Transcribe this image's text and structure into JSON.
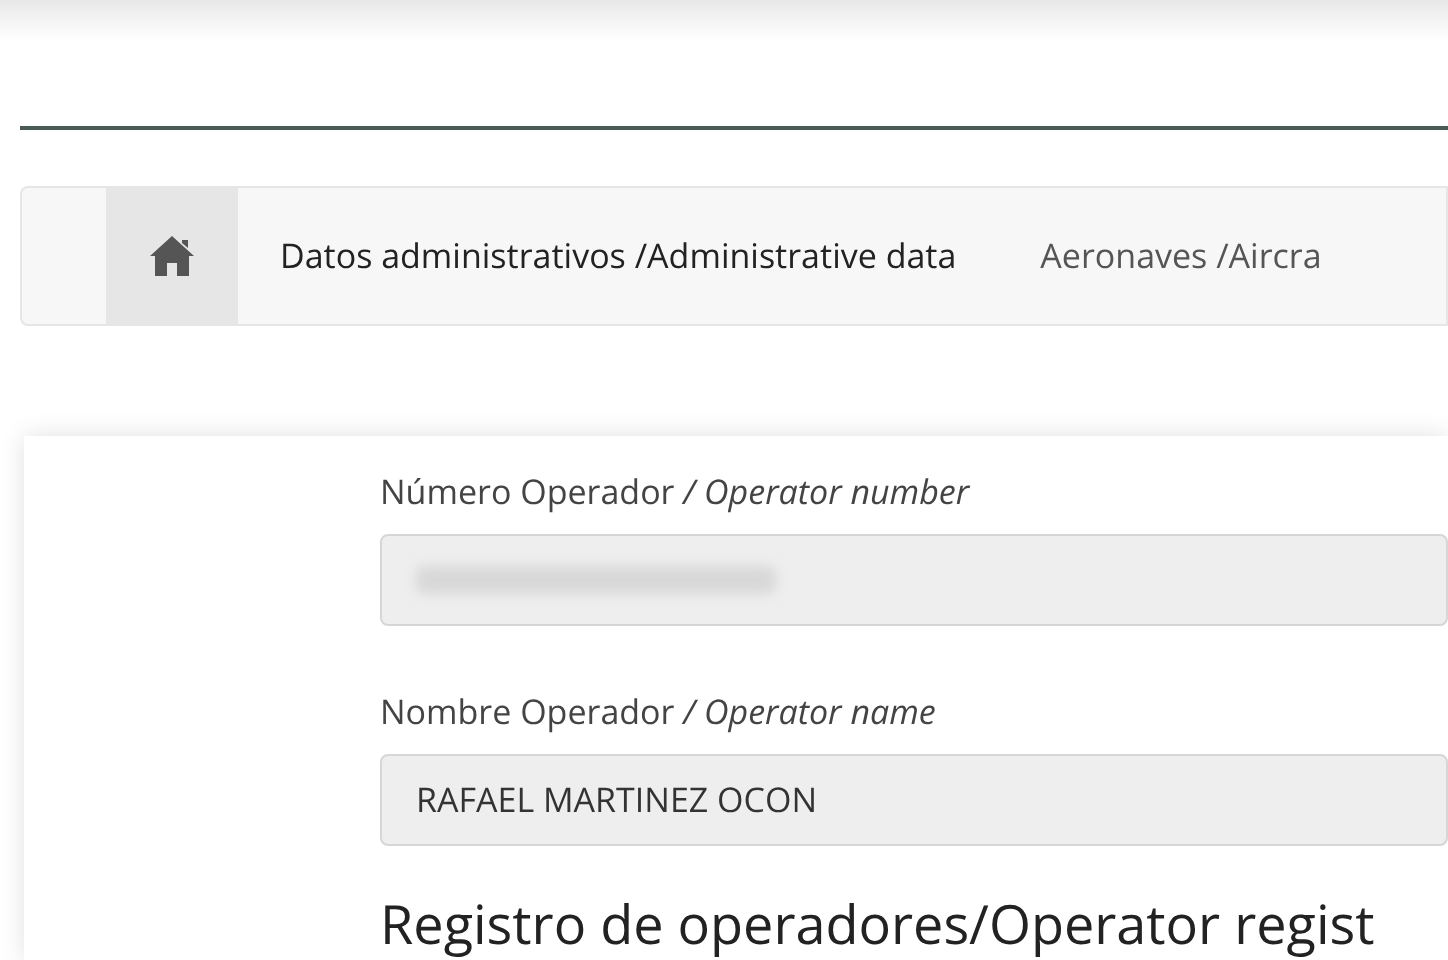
{
  "tabs": [
    {
      "kind": "home",
      "selected": true
    },
    {
      "kind": "text",
      "label": "Datos administrativos /Administrative data",
      "selected": false
    },
    {
      "kind": "text",
      "label": "Aeronaves /Aircra",
      "selected": false
    }
  ],
  "form": {
    "fields": [
      {
        "label": "Número Operador */ Operator number*",
        "kind": "redacted"
      },
      {
        "label": "Nombre Operador */ Operator name*",
        "kind": "text",
        "value": "RAFAEL MARTINEZ OCON"
      }
    ],
    "section_heading": "Registro de operadores/Operator regist"
  }
}
